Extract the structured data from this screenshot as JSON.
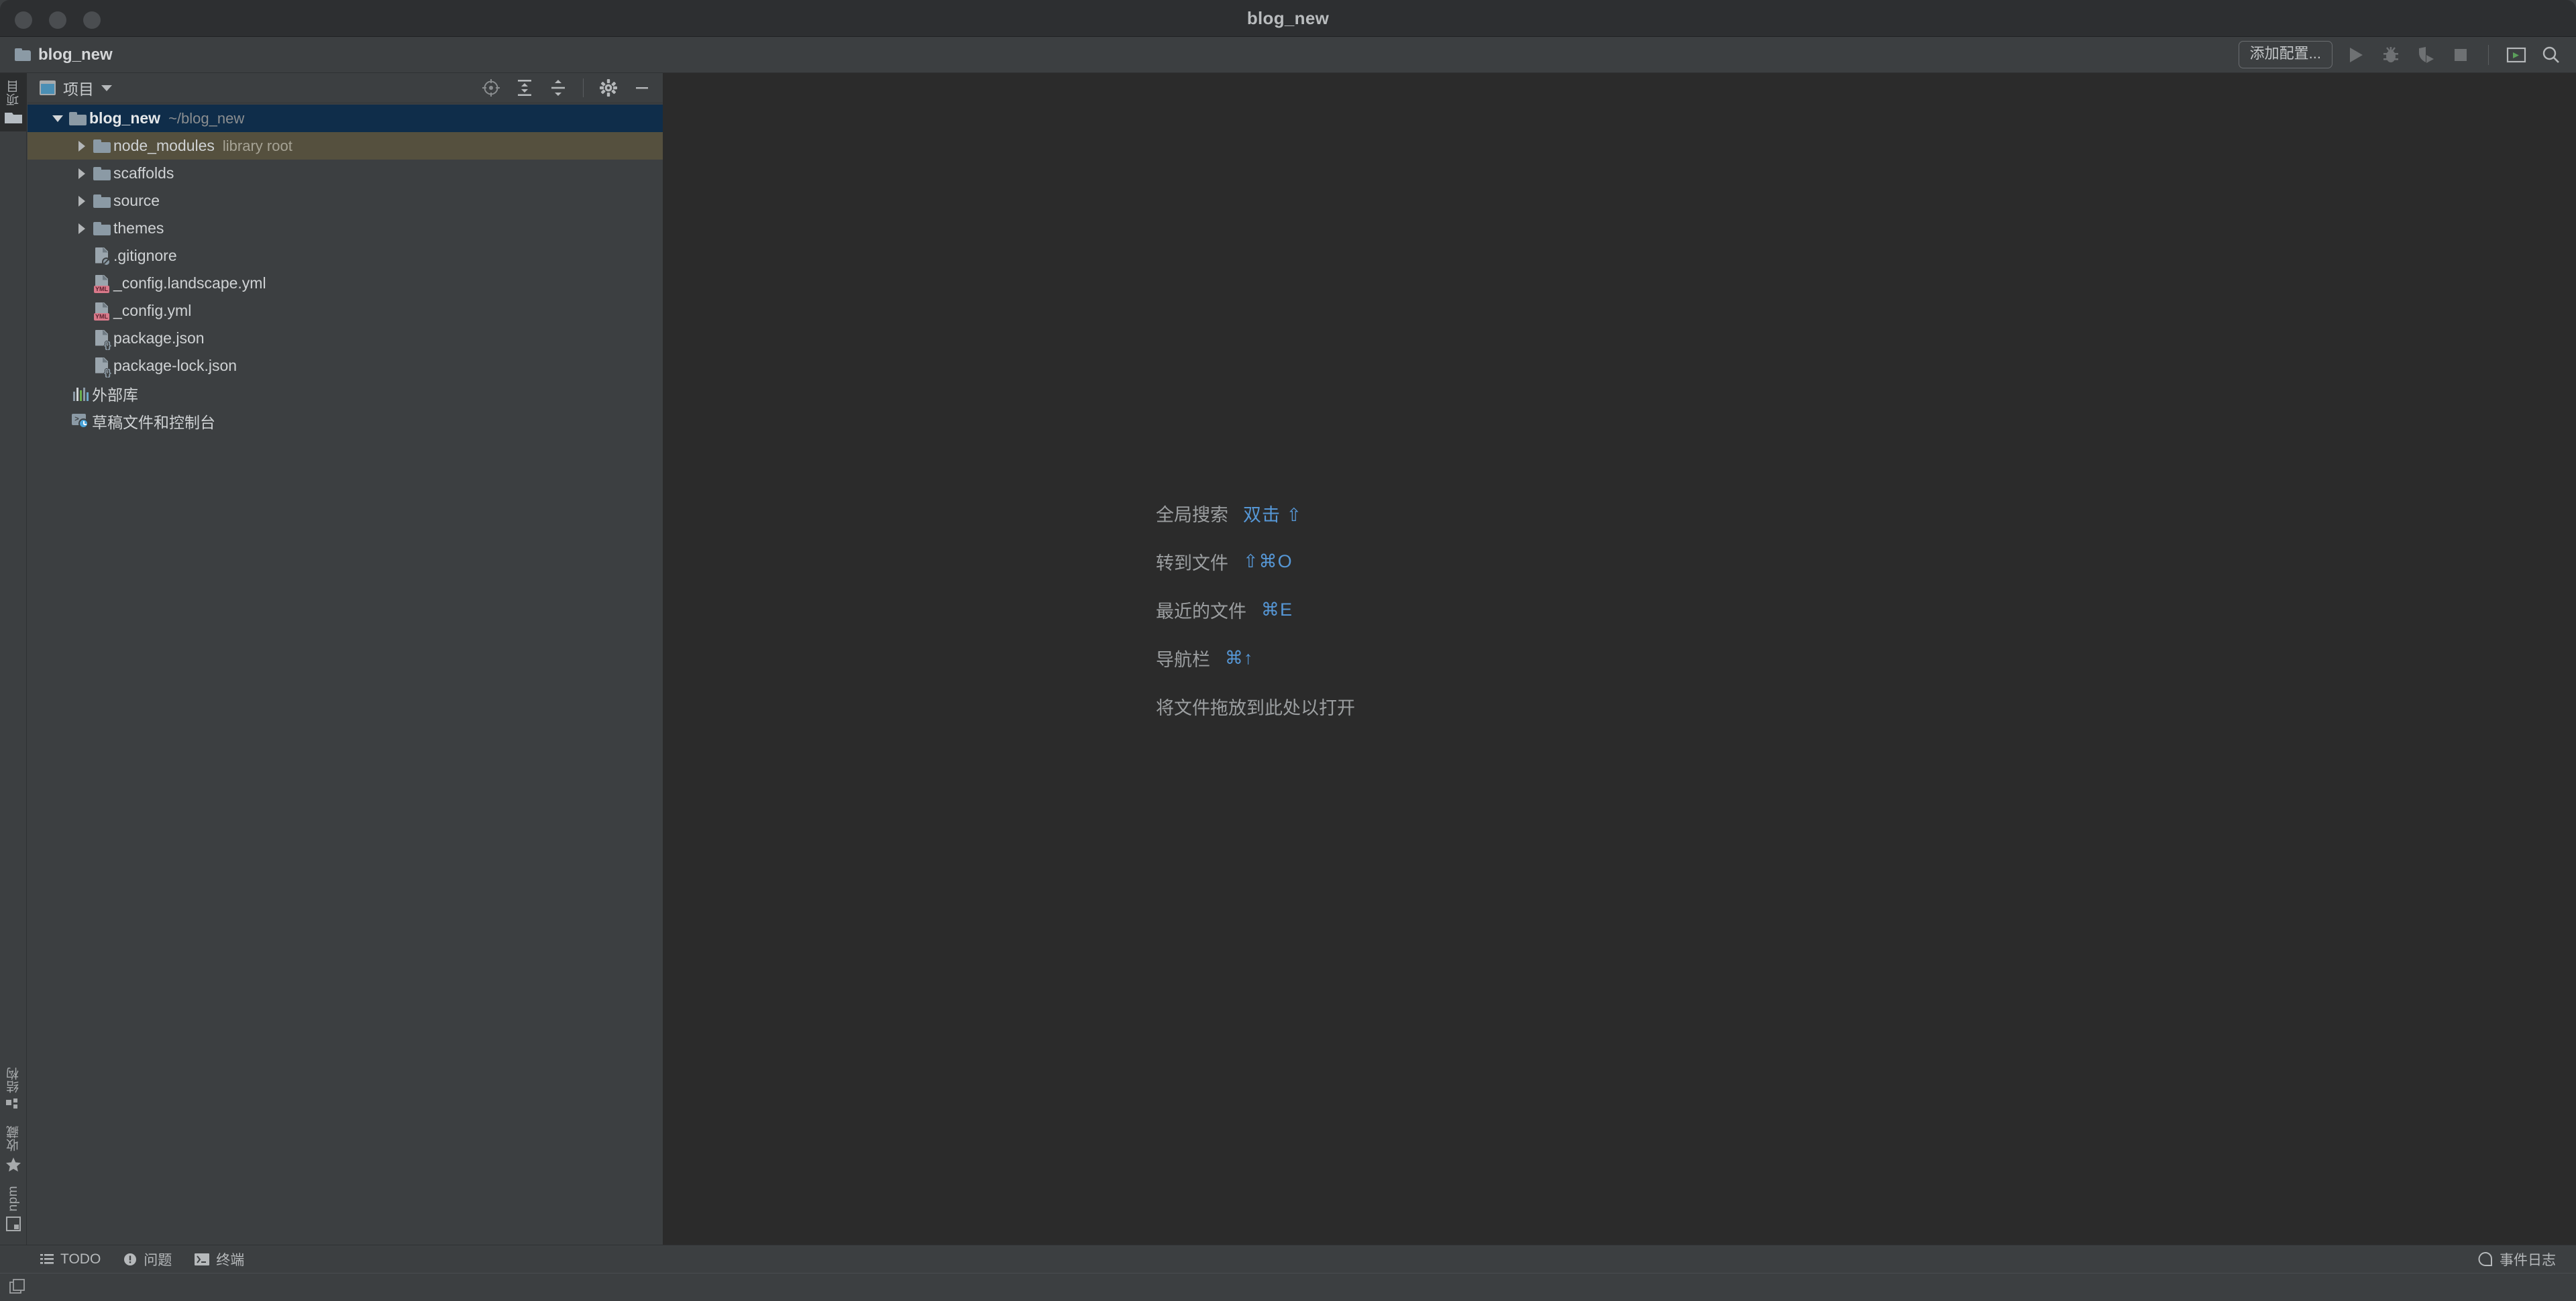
{
  "window": {
    "title": "blog_new",
    "traffic_lights": [
      "close-button",
      "minimize-button",
      "maximize-button"
    ]
  },
  "toolbar": {
    "breadcrumb": "blog_new",
    "breadcrumb_icon": "folder-icon",
    "add_configuration_label": "添加配置...",
    "actions": [
      {
        "name": "run-button",
        "icon": "play-icon",
        "enabled": false
      },
      {
        "name": "debug-button",
        "icon": "bug-icon",
        "enabled": false
      },
      {
        "name": "run-with-coverage-button",
        "icon": "shield-play-icon",
        "enabled": false
      },
      {
        "name": "stop-button",
        "icon": "stop-square-icon",
        "enabled": false
      },
      {
        "name": "run-anything-button",
        "icon": "terminal-play-icon",
        "enabled": true
      },
      {
        "name": "search-everywhere-button",
        "icon": "search-icon",
        "enabled": true
      }
    ]
  },
  "left_strip": {
    "top": [
      {
        "name": "sidebar-item-project",
        "label": "项目",
        "icon": "project-folder-icon",
        "active": true
      }
    ],
    "bottom": [
      {
        "name": "sidebar-item-structure",
        "label": "结构",
        "icon": "structure-icon"
      },
      {
        "name": "sidebar-item-favorites",
        "label": "收藏",
        "icon": "star-icon"
      },
      {
        "name": "sidebar-item-npm",
        "label": "npm",
        "icon": "npm-window-icon"
      }
    ]
  },
  "project_pane": {
    "title": "项目",
    "title_icon": "project-icon",
    "dropdown_icon": "chevron-down-icon",
    "actions": [
      {
        "name": "select-opened-file-button",
        "icon": "crosshair-locate-icon"
      },
      {
        "name": "expand-all-button",
        "icon": "expand-all-icon"
      },
      {
        "name": "collapse-all-button",
        "icon": "collapse-all-icon"
      },
      {
        "name": "pane-settings-button",
        "icon": "gear-icon"
      },
      {
        "name": "hide-pane-button",
        "icon": "minus-icon"
      }
    ],
    "tree": [
      {
        "name": "tree-row-blog-new",
        "label": "blog_new",
        "sub": "~/blog_new",
        "indent": 0,
        "twisty": "down",
        "icon": "folder-icon",
        "state": "selected",
        "bold": true
      },
      {
        "name": "tree-row-node-modules",
        "label": "node_modules",
        "sub": "library root",
        "indent": 1,
        "twisty": "right",
        "icon": "folder-icon",
        "state": "marked",
        "bold": false
      },
      {
        "name": "tree-row-scaffolds",
        "label": "scaffolds",
        "sub": "",
        "indent": 1,
        "twisty": "right",
        "icon": "folder-icon",
        "state": "none",
        "bold": false
      },
      {
        "name": "tree-row-source",
        "label": "source",
        "sub": "",
        "indent": 1,
        "twisty": "right",
        "icon": "folder-icon",
        "state": "none",
        "bold": false
      },
      {
        "name": "tree-row-themes",
        "label": "themes",
        "sub": "",
        "indent": 1,
        "twisty": "right",
        "icon": "folder-icon",
        "state": "none",
        "bold": false
      },
      {
        "name": "tree-row-gitignore",
        "label": ".gitignore",
        "sub": "",
        "indent": 1,
        "twisty": "none",
        "icon": "file-ignore-icon",
        "state": "none",
        "bold": false
      },
      {
        "name": "tree-row-config-landscape-yml",
        "label": "_config.landscape.yml",
        "sub": "",
        "indent": 1,
        "twisty": "none",
        "icon": "file-yml-icon",
        "state": "none",
        "bold": false
      },
      {
        "name": "tree-row-config-yml",
        "label": "_config.yml",
        "sub": "",
        "indent": 1,
        "twisty": "none",
        "icon": "file-yml-icon",
        "state": "none",
        "bold": false
      },
      {
        "name": "tree-row-package-json",
        "label": "package.json",
        "sub": "",
        "indent": 1,
        "twisty": "none",
        "icon": "file-json-icon",
        "state": "none",
        "bold": false
      },
      {
        "name": "tree-row-package-lock-json",
        "label": "package-lock.json",
        "sub": "",
        "indent": 1,
        "twisty": "none",
        "icon": "file-json-icon",
        "state": "none",
        "bold": false
      },
      {
        "name": "tree-row-external-libraries",
        "label": "外部库",
        "sub": "",
        "indent": 0.5,
        "twisty": "none",
        "icon": "libraries-icon",
        "state": "none",
        "bold": false
      },
      {
        "name": "tree-row-scratches-consoles",
        "label": "草稿文件和控制台",
        "sub": "",
        "indent": 0.5,
        "twisty": "none",
        "icon": "scratches-icon",
        "state": "none",
        "bold": false
      }
    ]
  },
  "editor": {
    "hints": [
      {
        "name": "hint-search-everywhere",
        "label": "全局搜索",
        "shortcut": "双击 ⇧"
      },
      {
        "name": "hint-go-to-file",
        "label": "转到文件",
        "shortcut": "⇧⌘O"
      },
      {
        "name": "hint-recent-files",
        "label": "最近的文件",
        "shortcut": "⌘E"
      },
      {
        "name": "hint-navigation-bar",
        "label": "导航栏",
        "shortcut": "⌘↑"
      }
    ],
    "drop_text": "将文件拖放到此处以打开"
  },
  "bottom_bar": {
    "items": [
      {
        "name": "bottom-item-todo",
        "label": "TODO",
        "icon": "list-icon"
      },
      {
        "name": "bottom-item-problems",
        "label": "问题",
        "icon": "exclamation-circle-icon"
      },
      {
        "name": "bottom-item-terminal",
        "label": "终端",
        "icon": "terminal-icon"
      }
    ],
    "event_log": {
      "name": "bottom-item-event-log",
      "label": "事件日志",
      "icon": "speech-bubble-icon"
    }
  },
  "status_bar": {
    "icon": "windows-stack-icon"
  },
  "colors": {
    "window_chrome": "#2d2f31",
    "panel_bg": "#3c3f41",
    "editor_bg": "#2b2b2b",
    "selection_blue": "#0f2d4a",
    "library_olive": "#55503e",
    "accent_blue": "#5697d6",
    "text_primary": "#cfd2d4",
    "text_muted": "#8b8e90"
  }
}
